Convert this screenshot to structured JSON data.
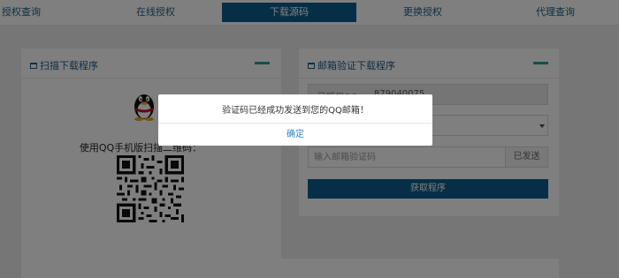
{
  "nav": {
    "tabs": [
      {
        "label": "授权查询",
        "active": false
      },
      {
        "label": "在线授权",
        "active": false
      },
      {
        "label": "下载源码",
        "active": true
      },
      {
        "label": "更换授权",
        "active": false
      },
      {
        "label": "代理查询",
        "active": false
      }
    ]
  },
  "scan_panel": {
    "title": "扫描下载程序",
    "instruction": "使用QQ手机版扫描二维码："
  },
  "email_panel": {
    "title": "邮箱验证下载程序",
    "qq_field": {
      "label": "已授权QQ",
      "value": "879040075"
    },
    "code_input": {
      "placeholder": "输入邮箱验证码",
      "value": ""
    },
    "sent_button": "已发送",
    "fetch_button": "获取程序"
  },
  "dialog": {
    "message": "验证码已经成功发送到您的QQ邮箱！",
    "confirm": "确定"
  },
  "colors": {
    "primary": "#0d5e8e",
    "accent_teal": "#1ea39a",
    "link_blue": "#2a87c9",
    "page_bg": "#ecedee",
    "overlay": "rgba(0,0,0,0.5)"
  },
  "icons": [
    "panel-icon",
    "collapse-icon",
    "qq-logo-icon",
    "qr-code-icon",
    "dropdown-arrow-icon"
  ]
}
